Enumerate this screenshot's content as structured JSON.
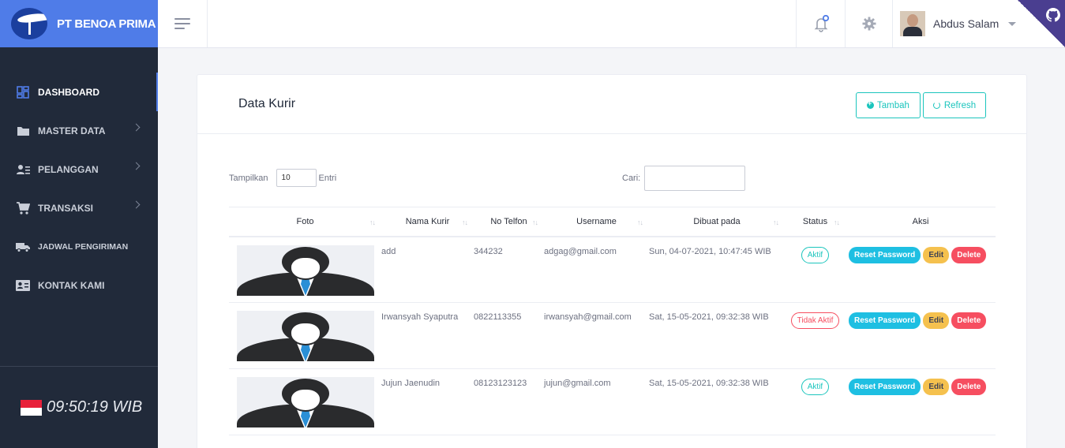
{
  "brand": {
    "name": "PT BENOA PRIMA"
  },
  "sidebar": {
    "items": [
      {
        "label": "DASHBOARD",
        "icon": "dashboard-icon",
        "active": true
      },
      {
        "label": "MASTER DATA",
        "icon": "folder-icon",
        "arrow": true
      },
      {
        "label": "PELANGGAN",
        "icon": "user-list-icon",
        "arrow": true
      },
      {
        "label": "TRANSAKSI",
        "icon": "cart-icon",
        "arrow": true
      },
      {
        "label": "JADWAL PENGIRIMAN",
        "icon": "truck-icon"
      },
      {
        "label": "KONTAK KAMI",
        "icon": "contact-card-icon"
      }
    ],
    "clock": "09:50:19 WIB"
  },
  "topbar": {
    "username": "Abdus Salam"
  },
  "card": {
    "title": "Data Kurir",
    "add_label": "Tambah",
    "refresh_label": "Refresh",
    "length_label": "Tampilkan",
    "length_value": "10",
    "length_suffix": "Entri",
    "search_label": "Cari:"
  },
  "table": {
    "headers": [
      "Foto",
      "Nama Kurir",
      "No Telfon",
      "Username",
      "Dibuat pada",
      "Status",
      "Aksi"
    ],
    "rows": [
      {
        "nama": "add",
        "telfon": "344232",
        "username": "adgag@gmail.com",
        "dibuat": "Sun, 04-07-2021, 10:47:45 WIB",
        "status": "Aktif"
      },
      {
        "nama": "Irwansyah Syaputra",
        "telfon": "0822113355",
        "username": "irwansyah@gmail.com",
        "dibuat": "Sat, 15-05-2021, 09:32:38 WIB",
        "status": "Tidak Aktif"
      },
      {
        "nama": "Jujun Jaenudin",
        "telfon": "08123123123",
        "username": "jujun@gmail.com",
        "dibuat": "Sat, 15-05-2021, 09:32:38 WIB",
        "status": "Aktif"
      }
    ],
    "actions": {
      "reset": "Reset Password",
      "edit": "Edit",
      "delete": "Delete"
    }
  },
  "colors": {
    "brand": "#4f7ce8",
    "sidebar": "#212a3a",
    "success": "#1bc5bd",
    "danger": "#f64e60",
    "warning": "#f5c14e",
    "info": "#1ebfe2"
  }
}
